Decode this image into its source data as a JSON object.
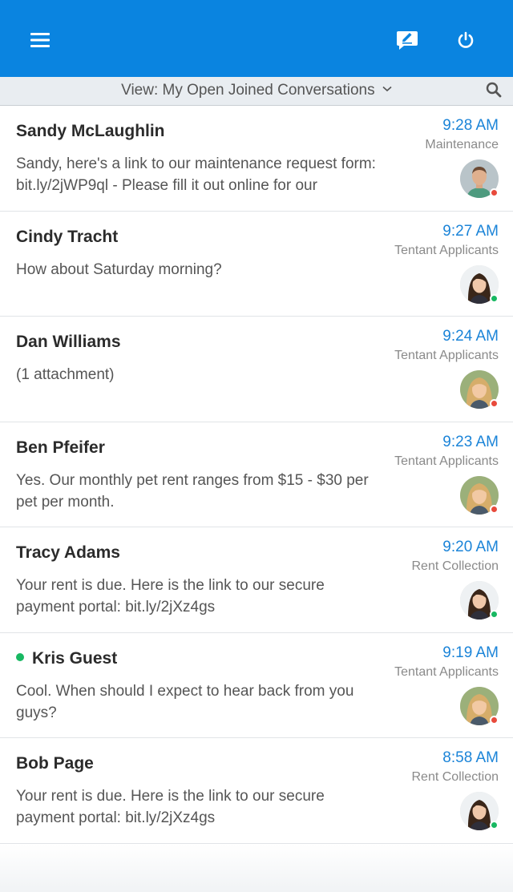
{
  "header": {
    "menu_icon": "hamburger-menu-icon",
    "compose_icon": "compose-message-icon",
    "power_icon": "power-icon",
    "brand_color": "#0a84e0"
  },
  "view_bar": {
    "label": "View: My Open Joined Conversations",
    "caret_icon": "chevron-down-icon",
    "search_icon": "search-icon"
  },
  "conversations": [
    {
      "name": "Sandy McLaughlin",
      "online": false,
      "message": "Sandy, here's a link to our maintenance request form: bit.ly/2jWP9ql - Please fill it out online for our",
      "time": "9:28 AM",
      "group": "Maintenance",
      "avatar": "man",
      "status_color": "#e84a3c"
    },
    {
      "name": "Cindy Tracht",
      "online": false,
      "message": "How about Saturday morning?",
      "time": "9:27 AM",
      "group": "Tentant Applicants",
      "avatar": "dark-hair-woman",
      "status_color": "#18b862"
    },
    {
      "name": "Dan Williams",
      "online": false,
      "message": "(1 attachment)",
      "time": "9:24 AM",
      "group": "Tentant Applicants",
      "avatar": "blonde-woman",
      "status_color": "#e84a3c"
    },
    {
      "name": "Ben Pfeifer",
      "online": false,
      "message": "Yes. Our monthly pet rent ranges from $15 - $30 per pet per month.",
      "time": "9:23 AM",
      "group": "Tentant Applicants",
      "avatar": "blonde-woman",
      "status_color": "#e84a3c"
    },
    {
      "name": "Tracy Adams",
      "online": false,
      "message": "Your rent is due. Here is the link to our secure payment portal: bit.ly/2jXz4gs",
      "time": "9:20 AM",
      "group": "Rent Collection",
      "avatar": "dark-hair-woman",
      "status_color": "#18b862"
    },
    {
      "name": "Kris Guest",
      "online": true,
      "message": "Cool. When should I expect to hear back from you guys?",
      "time": "9:19 AM",
      "group": "Tentant Applicants",
      "avatar": "blonde-woman",
      "status_color": "#e84a3c"
    },
    {
      "name": "Bob Page",
      "online": false,
      "message": "Your rent is due. Here is the link to our secure payment portal: bit.ly/2jXz4gs",
      "time": "8:58 AM",
      "group": "Rent Collection",
      "avatar": "dark-hair-woman",
      "status_color": "#18b862"
    }
  ]
}
